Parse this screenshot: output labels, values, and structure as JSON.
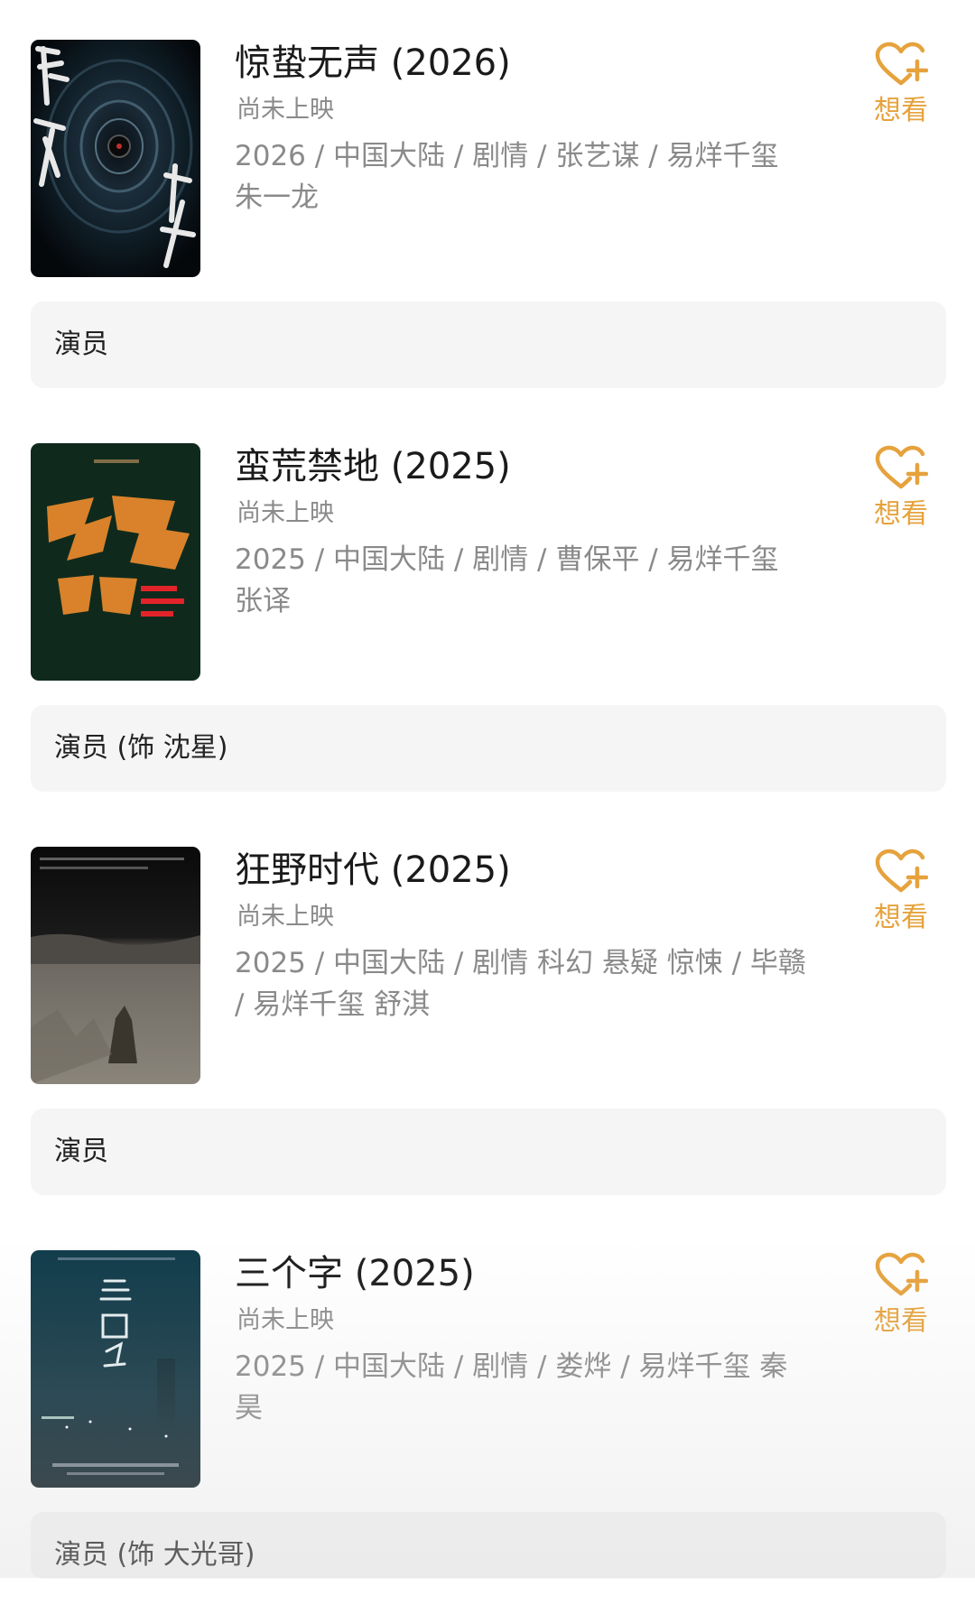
{
  "colors": {
    "accent": "#e6a23c",
    "title": "#1a1a1a",
    "secondary": "#8a8a8a",
    "role_bar_bg": "#f5f5f5"
  },
  "movies": [
    {
      "title": "惊蛰无声 (2026)",
      "status": "尚未上映",
      "meta": "2026 / 中国大陆 / 剧情 / 张艺谋 / 易烊千玺 朱一龙",
      "wish_label": "想看",
      "wish_icon": "heart-plus-icon",
      "role": "演员"
    },
    {
      "title": "蛮荒禁地 (2025)",
      "status": "尚未上映",
      "meta": "2025 / 中国大陆 / 剧情 / 曹保平 / 易烊千玺 张译",
      "wish_label": "想看",
      "wish_icon": "heart-plus-icon",
      "role": "演员 (饰 沈星)"
    },
    {
      "title": "狂野时代 (2025)",
      "status": "尚未上映",
      "meta": "2025 / 中国大陆 / 剧情 科幻 悬疑 惊悚 / 毕赣 / 易烊千玺 舒淇",
      "wish_label": "想看",
      "wish_icon": "heart-plus-icon",
      "role": "演员"
    },
    {
      "title": "三个字 (2025)",
      "status": "尚未上映",
      "meta": "2025 / 中国大陆 / 剧情 / 娄烨 / 易烊千玺 秦昊",
      "wish_label": "想看",
      "wish_icon": "heart-plus-icon",
      "role": "演员 (饰 大光哥)"
    }
  ]
}
